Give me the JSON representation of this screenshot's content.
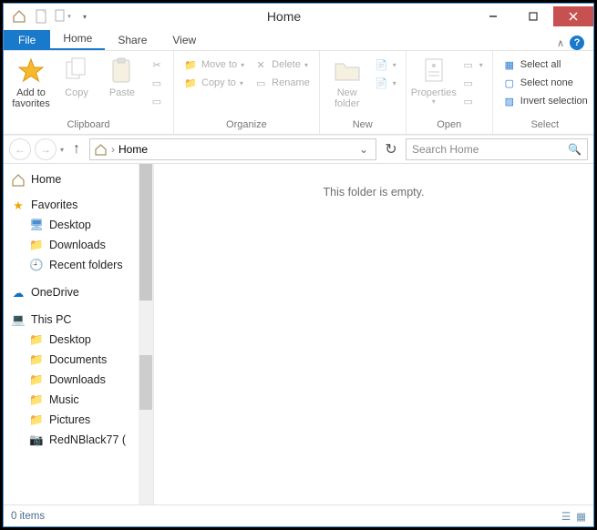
{
  "window": {
    "title": "Home"
  },
  "tabs": {
    "file": "File",
    "home": "Home",
    "share": "Share",
    "view": "View"
  },
  "ribbon": {
    "clipboard": {
      "label": "Clipboard",
      "addto": "Add to favorites",
      "copy": "Copy",
      "paste": "Paste"
    },
    "organize": {
      "label": "Organize",
      "moveto": "Move to",
      "copyto": "Copy to",
      "delete": "Delete",
      "rename": "Rename"
    },
    "new": {
      "label": "New",
      "newfolder": "New folder"
    },
    "open": {
      "label": "Open",
      "properties": "Properties"
    },
    "select": {
      "label": "Select",
      "all": "Select all",
      "none": "Select none",
      "invert": "Invert selection"
    }
  },
  "address": {
    "crumb": "Home",
    "search_placeholder": "Search Home"
  },
  "tree": {
    "home": "Home",
    "favorites": "Favorites",
    "desktop": "Desktop",
    "downloads": "Downloads",
    "recent": "Recent folders",
    "onedrive": "OneDrive",
    "thispc": "This PC",
    "pc_desktop": "Desktop",
    "pc_documents": "Documents",
    "pc_downloads": "Downloads",
    "pc_music": "Music",
    "pc_pictures": "Pictures",
    "pc_last": "RedNBlack77 ("
  },
  "pane": {
    "empty": "This folder is empty."
  },
  "status": {
    "items": "0 items"
  }
}
